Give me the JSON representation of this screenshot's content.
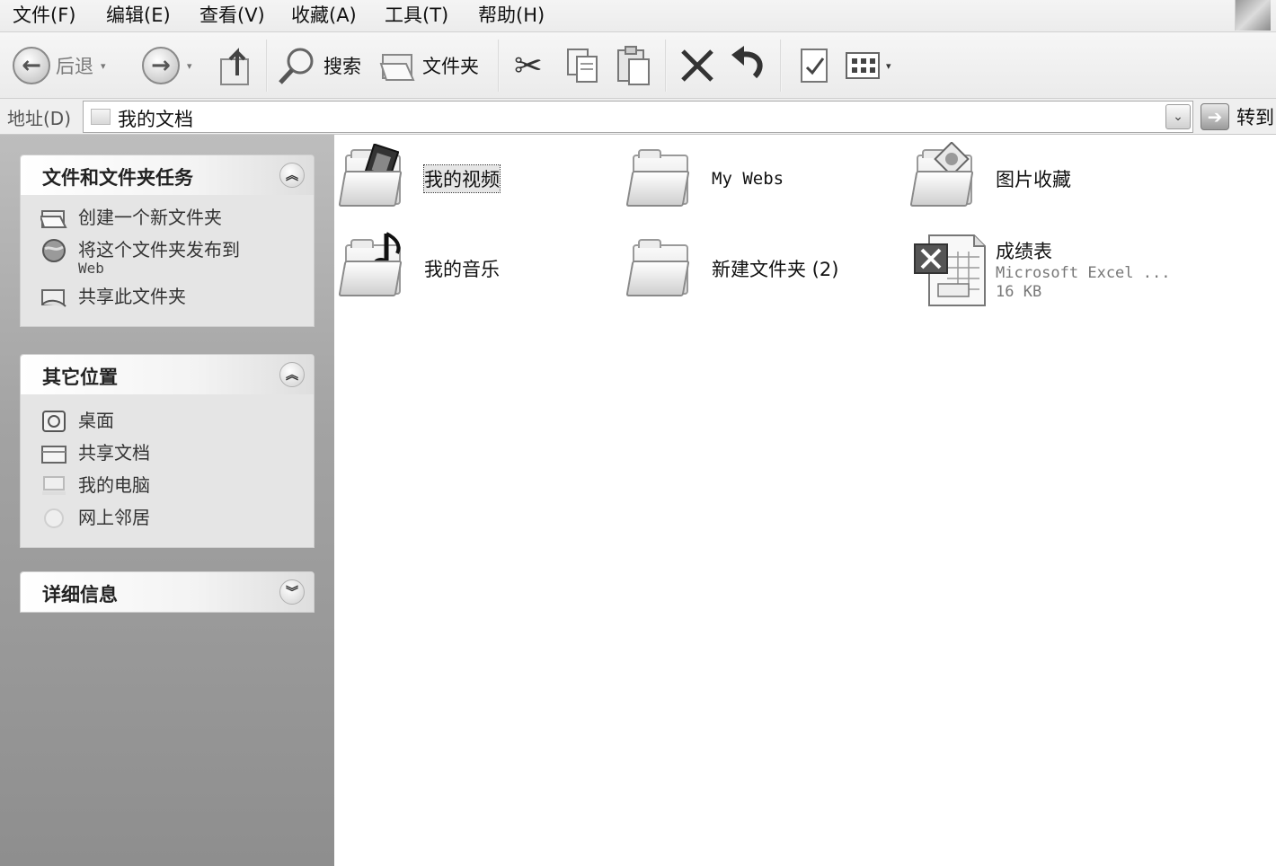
{
  "menu": {
    "items": [
      "文件(F)",
      "编辑(E)",
      "查看(V)",
      "收藏(A)",
      "工具(T)",
      "帮助(H)"
    ]
  },
  "toolbar": {
    "back_label": "后退",
    "search_label": "搜索",
    "folders_label": "文件夹"
  },
  "address": {
    "label": "地址(D)",
    "value": "我的文档",
    "go_label": "转到"
  },
  "tasks_panel": {
    "title": "文件和文件夹任务",
    "items": [
      {
        "label": "创建一个新文件夹",
        "icon": "new-folder-icon"
      },
      {
        "label": "将这个文件夹发布到",
        "sub": "Web",
        "icon": "globe-icon"
      },
      {
        "label": "共享此文件夹",
        "icon": "share-folder-icon"
      }
    ]
  },
  "places_panel": {
    "title": "其它位置",
    "items": [
      {
        "label": "桌面",
        "icon": "desktop-icon"
      },
      {
        "label": "共享文档",
        "icon": "folder-icon"
      },
      {
        "label": "我的电脑",
        "icon": "computer-icon"
      },
      {
        "label": "网上邻居",
        "icon": "network-icon"
      }
    ]
  },
  "details_panel": {
    "title": "详细信息"
  },
  "files": [
    {
      "name": "我的视频",
      "icon": "video-folder-icon",
      "selected": true
    },
    {
      "name": "My Webs",
      "icon": "folder-icon"
    },
    {
      "name": "图片收藏",
      "icon": "pictures-folder-icon"
    },
    {
      "name": "我的音乐",
      "icon": "music-folder-icon"
    },
    {
      "name": "新建文件夹 (2)",
      "icon": "folder-icon"
    },
    {
      "name": "成绩表",
      "icon": "excel-file-icon",
      "type": "Microsoft Excel ...",
      "size": "16 KB"
    }
  ]
}
